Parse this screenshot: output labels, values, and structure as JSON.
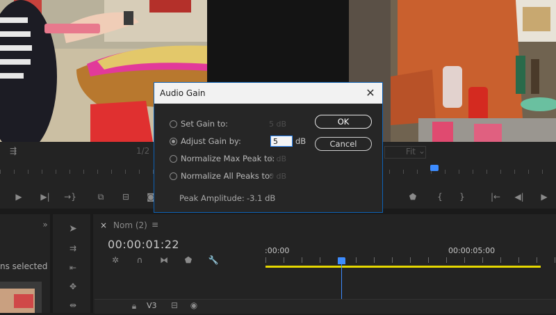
{
  "source_monitor": {
    "zoom_label": "1/2"
  },
  "program_monitor": {
    "fit_label": "Fit"
  },
  "project_panel": {
    "selection_status": "ns selected"
  },
  "timeline": {
    "sequence_tab": "Nom (2)",
    "timecode": "00:00:01:22",
    "ruler_start": ":00:00",
    "ruler_mark": "00:00:05:00",
    "track_name": "V3"
  },
  "dialog": {
    "title": "Audio Gain",
    "close_glyph": "✕",
    "options": [
      {
        "label": "Set Gain to:",
        "value": "5 dB"
      },
      {
        "label": "Adjust Gain by:",
        "value": "5",
        "unit": "dB"
      },
      {
        "label": "Normalize Max Peak to:",
        "value": "0 dB"
      },
      {
        "label": "Normalize All Peaks to:",
        "value": "0 dB"
      }
    ],
    "selected_option": "Adjust Gain by:",
    "peak_label": "Peak Amplitude:",
    "peak_value": "-3.1 dB",
    "ok_label": "OK",
    "cancel_label": "Cancel"
  },
  "icons": [
    "play-icon",
    "step-forward-icon",
    "shuttle-icon",
    "insert-icon",
    "overwrite-icon",
    "export-frame-icon",
    "marker-icon",
    "in-point-icon",
    "out-point-icon",
    "go-to-in-icon",
    "step-back-icon",
    "selection-tool-icon",
    "track-select-icon",
    "ripple-edit-icon",
    "razor-icon",
    "snap-icon",
    "linked-icon",
    "add-marker-icon",
    "wrench-icon",
    "lock-icon",
    "eye-icon",
    "panel-menu-icon",
    "close-icon"
  ],
  "colors": {
    "accent": "#3d8cff",
    "work_area": "#e6d800",
    "dialog_border": "#0d63b8"
  }
}
